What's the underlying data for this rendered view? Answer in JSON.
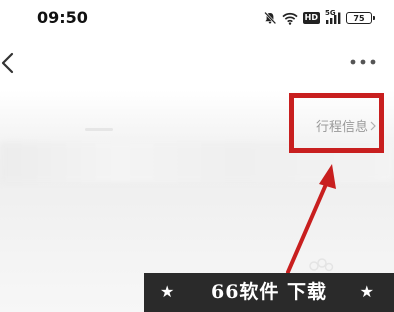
{
  "status_bar": {
    "time": "09:50",
    "hd_label": "HD",
    "network_label": "5G",
    "battery_level": "75"
  },
  "content": {
    "itinerary_link": "行程信息"
  },
  "watermark": {
    "text": "66软件 下载",
    "star": "★"
  },
  "colors": {
    "highlight": "#c81f1f",
    "link_gray": "#9a9a9a",
    "watermark_bg": "#2a2a2a"
  },
  "icons": {
    "back": "chevron-left-icon",
    "more": "more-icon",
    "mute": "bell-off-icon",
    "wifi": "wifi-icon",
    "signal": "signal-icon",
    "battery": "battery-icon",
    "link_chevron": "chevron-right-icon"
  }
}
